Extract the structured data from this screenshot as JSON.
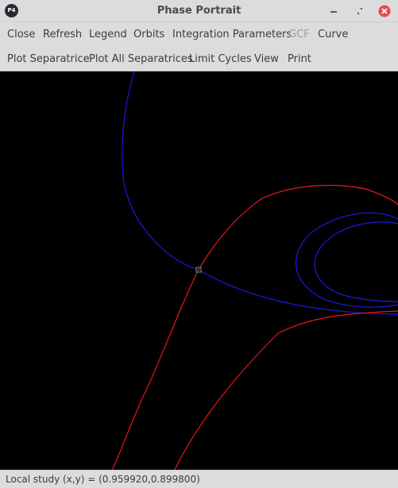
{
  "window": {
    "title": "Phase Portrait",
    "app_icon_text": "P4",
    "controls": [
      "minimize",
      "maximize",
      "close"
    ]
  },
  "menu_row1": [
    {
      "label": "Close",
      "enabled": true
    },
    {
      "label": "Refresh",
      "enabled": true
    },
    {
      "label": "Legend",
      "enabled": true
    },
    {
      "label": "Orbits",
      "enabled": true
    },
    {
      "label": "Integration Parameters",
      "enabled": true
    },
    {
      "label": "GCF",
      "enabled": false
    },
    {
      "label": "Curve",
      "enabled": true
    }
  ],
  "menu_row2": [
    {
      "label": "Plot Separatrice",
      "enabled": true
    },
    {
      "label": "Plot All Separatrices",
      "enabled": true
    },
    {
      "label": "Limit Cycles",
      "enabled": true
    },
    {
      "label": "View",
      "enabled": true
    },
    {
      "label": "Print",
      "enabled": true
    }
  ],
  "plot": {
    "background": "#000000",
    "curve_colors": {
      "blue_orbit": "#1a1adc",
      "red_orbit": "#e81818"
    },
    "singular_point_color": "#2e8b57"
  },
  "status": {
    "mode": "Local study",
    "coords": "(x,y) = (0.959920,0.899800)"
  }
}
